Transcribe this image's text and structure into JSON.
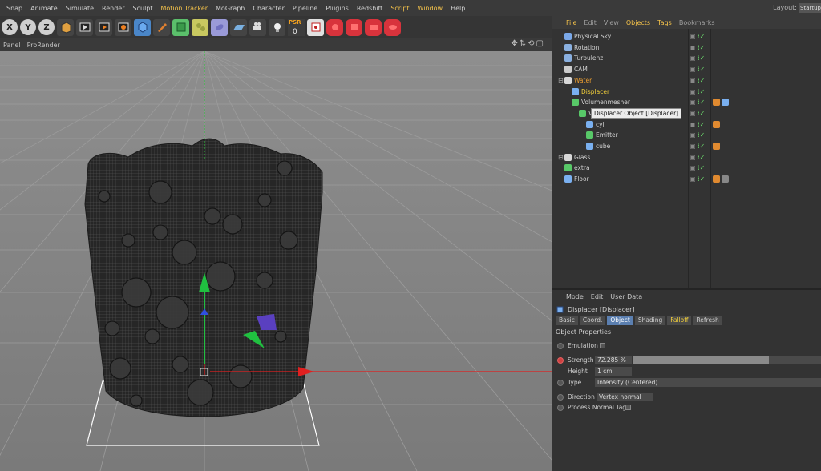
{
  "menubar": {
    "items": [
      "Snap",
      "Animate",
      "Simulate",
      "Render",
      "Sculpt",
      "Motion Tracker",
      "MoGraph",
      "Character",
      "Pipeline",
      "Plugins",
      "Redshift",
      "Script",
      "Window",
      "Help"
    ],
    "highlighted": [
      "Motion Tracker",
      "Script",
      "Window"
    ],
    "layout_label": "Layout:",
    "layout_value": "Startup"
  },
  "toolbar": {
    "axis_x": "X",
    "axis_y": "Y",
    "axis_z": "Z",
    "psr_top": "PSR",
    "psr_bottom": "0",
    "icons": [
      "world-axis-icon",
      "render-view-icon",
      "render-picture-viewer-icon",
      "render-settings-icon",
      "cube-object-icon",
      "pen-spline-icon",
      "subdivision-icon",
      "array-icon",
      "deformer-icon",
      "floor-icon",
      "camera-icon",
      "light-icon",
      "psr-icon",
      "tag-icon",
      "material-red-1-icon",
      "material-red-2-icon",
      "material-red-3-icon",
      "material-red-4-icon"
    ]
  },
  "viewport_header": {
    "panel": "Panel",
    "prorender": "ProRender"
  },
  "object_manager": {
    "menu": [
      "File",
      "Edit",
      "View",
      "Objects",
      "Tags",
      "Bookmarks"
    ],
    "highlighted": [
      "File",
      "Objects",
      "Tags"
    ],
    "tree": [
      {
        "name": "Physical Sky",
        "indent": 0,
        "color": "normal",
        "icon": "sky-icon"
      },
      {
        "name": "Rotation",
        "indent": 0,
        "color": "normal",
        "icon": "rotation-field-icon"
      },
      {
        "name": "Turbulenz",
        "indent": 0,
        "color": "normal",
        "icon": "turbulence-icon"
      },
      {
        "name": "CAM",
        "indent": 0,
        "color": "normal",
        "icon": "camera-icon"
      },
      {
        "name": "Water",
        "indent": 0,
        "color": "orange",
        "icon": "null-object-icon"
      },
      {
        "name": "Displacer",
        "indent": 1,
        "color": "yellow",
        "icon": "displacer-icon"
      },
      {
        "name": "Volumenmesher",
        "indent": 1,
        "color": "normal",
        "icon": "volume-mesher-icon"
      },
      {
        "name": "V",
        "indent": 2,
        "color": "normal",
        "icon": "volume-builder-icon"
      },
      {
        "name": "cyl",
        "indent": 3,
        "color": "normal",
        "icon": "cylinder-icon"
      },
      {
        "name": "Emitter",
        "indent": 3,
        "color": "normal",
        "icon": "emitter-icon"
      },
      {
        "name": "cube",
        "indent": 3,
        "color": "normal",
        "icon": "cube-icon"
      },
      {
        "name": "Glass",
        "indent": 0,
        "color": "normal",
        "icon": "null-object-icon"
      },
      {
        "name": "extra",
        "indent": 0,
        "color": "normal",
        "icon": "extra-icon"
      },
      {
        "name": "Floor",
        "indent": 0,
        "color": "normal",
        "icon": "floor-icon"
      }
    ],
    "tooltip": "Displacer Object [Displacer]"
  },
  "attribute_manager": {
    "menu": [
      "Mode",
      "Edit",
      "User Data"
    ],
    "title": "Displacer [Displacer]",
    "tabs": [
      "Basic",
      "Coord.",
      "Object",
      "Shading",
      "Falloff",
      "Refresh"
    ],
    "active_tab": "Object",
    "section": "Object Properties",
    "emulation_label": "Emulation",
    "strength_label": "Strength",
    "strength_value": "72.285 %",
    "strength_fraction": 0.72285,
    "height_label": "Height",
    "height_value": "1 cm",
    "type_label": "Type. . . .",
    "type_value": "Intensity (Centered)",
    "direction_label": "Direction",
    "direction_value": "Vertex normal",
    "process_label": "Process Normal Tag"
  },
  "colors": {
    "accent_yellow": "#f4c24a",
    "active_tab": "#5b7fb0",
    "axis_red": "#e02020",
    "axis_green": "#20c040",
    "axis_blue": "#3050e0"
  }
}
